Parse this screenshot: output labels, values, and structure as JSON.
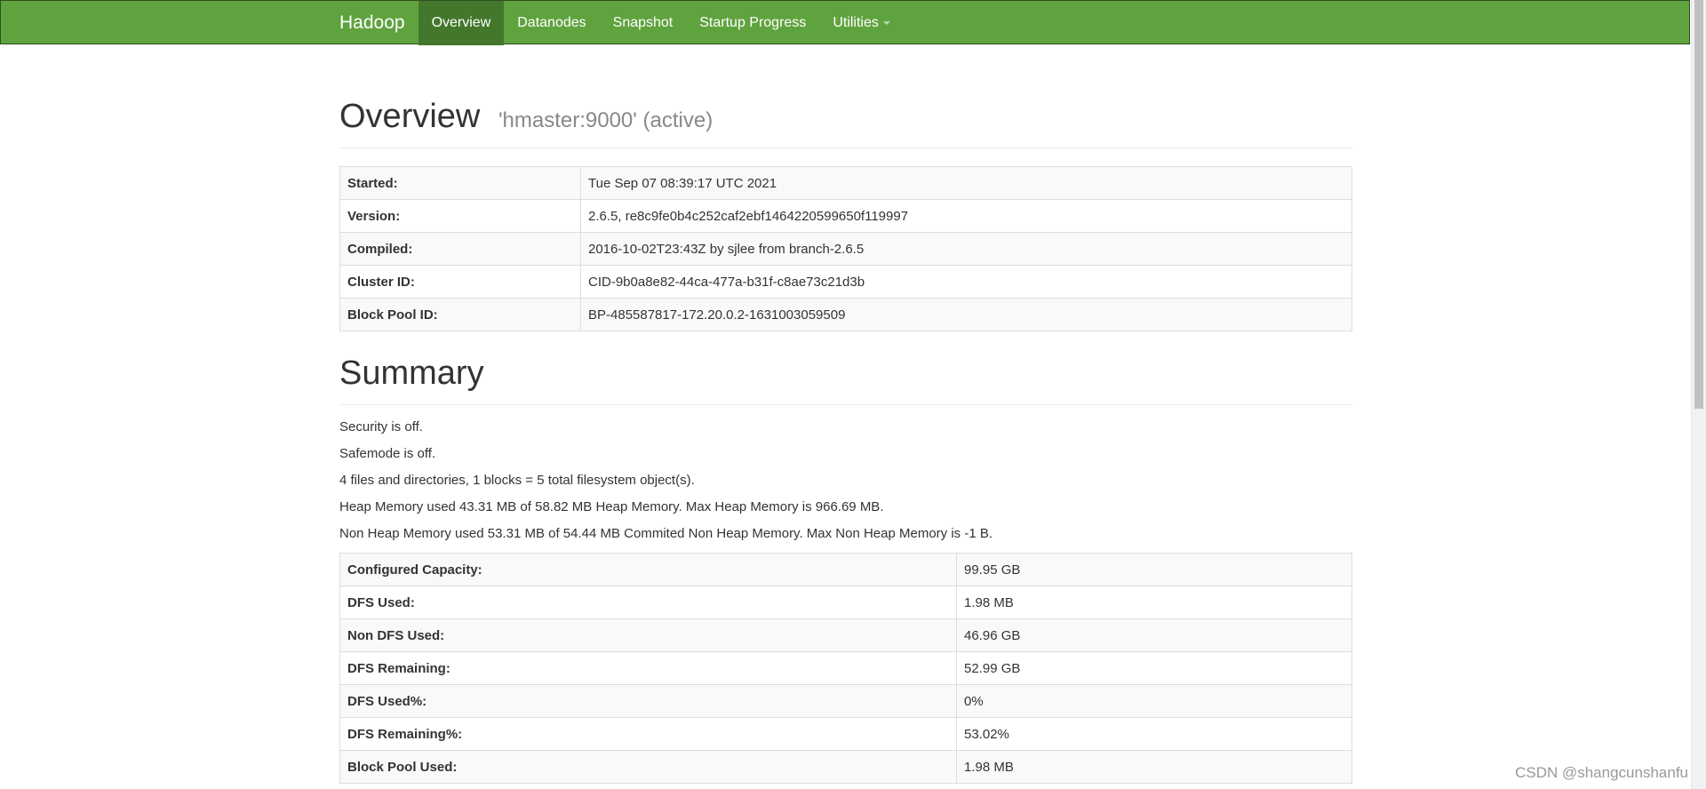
{
  "navbar": {
    "brand": "Hadoop",
    "items": [
      {
        "label": "Overview",
        "active": true
      },
      {
        "label": "Datanodes",
        "active": false
      },
      {
        "label": "Snapshot",
        "active": false
      },
      {
        "label": "Startup Progress",
        "active": false
      },
      {
        "label": "Utilities",
        "active": false,
        "dropdown": true
      }
    ]
  },
  "overview": {
    "title": "Overview",
    "subtitle": "'hmaster:9000' (active)",
    "rows": [
      {
        "label": "Started:",
        "value": "Tue Sep 07 08:39:17 UTC 2021"
      },
      {
        "label": "Version:",
        "value": "2.6.5, re8c9fe0b4c252caf2ebf1464220599650f119997"
      },
      {
        "label": "Compiled:",
        "value": "2016-10-02T23:43Z by sjlee from branch-2.6.5"
      },
      {
        "label": "Cluster ID:",
        "value": "CID-9b0a8e82-44ca-477a-b31f-c8ae73c21d3b"
      },
      {
        "label": "Block Pool ID:",
        "value": "BP-485587817-172.20.0.2-1631003059509"
      }
    ]
  },
  "summary": {
    "title": "Summary",
    "lines": [
      "Security is off.",
      "Safemode is off.",
      "4 files and directories, 1 blocks = 5 total filesystem object(s).",
      "Heap Memory used 43.31 MB of 58.82 MB Heap Memory. Max Heap Memory is 966.69 MB.",
      "Non Heap Memory used 53.31 MB of 54.44 MB Commited Non Heap Memory. Max Non Heap Memory is -1 B."
    ],
    "rows": [
      {
        "label": "Configured Capacity:",
        "value": "99.95 GB"
      },
      {
        "label": "DFS Used:",
        "value": "1.98 MB"
      },
      {
        "label": "Non DFS Used:",
        "value": "46.96 GB"
      },
      {
        "label": "DFS Remaining:",
        "value": "52.99 GB"
      },
      {
        "label": "DFS Used%:",
        "value": "0%"
      },
      {
        "label": "DFS Remaining%:",
        "value": "53.02%"
      },
      {
        "label": "Block Pool Used:",
        "value": "1.98 MB"
      }
    ]
  },
  "watermark": "CSDN @shangcunshanfu"
}
